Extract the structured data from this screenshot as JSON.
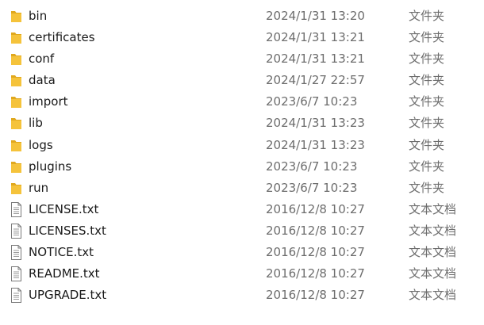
{
  "files": [
    {
      "name": "bin",
      "date": "2024/1/31 13:20",
      "type": "文件夹",
      "icon": "folder-icon"
    },
    {
      "name": "certificates",
      "date": "2024/1/31 13:21",
      "type": "文件夹",
      "icon": "folder-icon"
    },
    {
      "name": "conf",
      "date": "2024/1/31 13:21",
      "type": "文件夹",
      "icon": "folder-icon"
    },
    {
      "name": "data",
      "date": "2024/1/27 22:57",
      "type": "文件夹",
      "icon": "folder-icon"
    },
    {
      "name": "import",
      "date": "2023/6/7 10:23",
      "type": "文件夹",
      "icon": "folder-icon"
    },
    {
      "name": "lib",
      "date": "2024/1/31 13:23",
      "type": "文件夹",
      "icon": "folder-icon"
    },
    {
      "name": "logs",
      "date": "2024/1/31 13:23",
      "type": "文件夹",
      "icon": "folder-icon"
    },
    {
      "name": "plugins",
      "date": "2023/6/7 10:23",
      "type": "文件夹",
      "icon": "folder-icon"
    },
    {
      "name": "run",
      "date": "2023/6/7 10:23",
      "type": "文件夹",
      "icon": "folder-icon"
    },
    {
      "name": "LICENSE.txt",
      "date": "2016/12/8 10:27",
      "type": "文本文档",
      "icon": "text-file-icon"
    },
    {
      "name": "LICENSES.txt",
      "date": "2016/12/8 10:27",
      "type": "文本文档",
      "icon": "text-file-icon"
    },
    {
      "name": "NOTICE.txt",
      "date": "2016/12/8 10:27",
      "type": "文本文档",
      "icon": "text-file-icon"
    },
    {
      "name": "README.txt",
      "date": "2016/12/8 10:27",
      "type": "文本文档",
      "icon": "text-file-icon"
    },
    {
      "name": "UPGRADE.txt",
      "date": "2016/12/8 10:27",
      "type": "文本文档",
      "icon": "text-file-icon"
    }
  ],
  "colors": {
    "folder": "#f5c33b",
    "folder_dark": "#e0a81e",
    "doc_border": "#7a7a7a",
    "doc_lines": "#9a9a9a",
    "meta_text": "#6d6d6d"
  }
}
